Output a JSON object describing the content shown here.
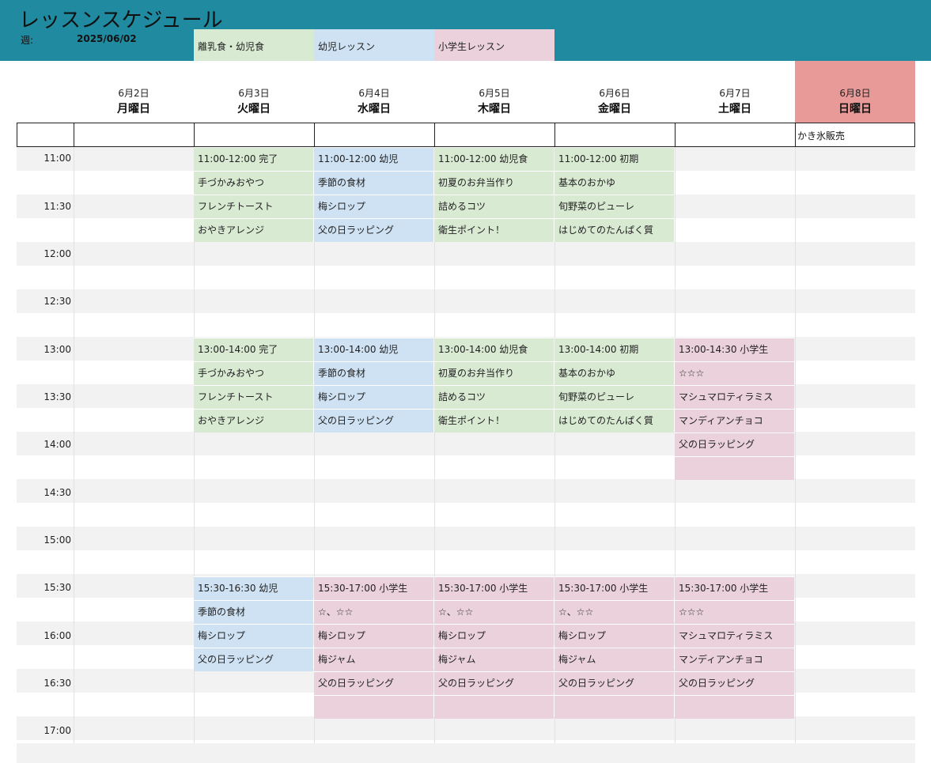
{
  "title": "レッスンスケジュール",
  "week_label": "週:",
  "week_value": "2025/06/02",
  "legend": [
    {
      "label": "離乳食・幼児食",
      "color": "#d9ead3"
    },
    {
      "label": "幼児レッスン",
      "color": "#cfe2f3"
    },
    {
      "label": "小学生レッスン",
      "color": "#ead1dc"
    }
  ],
  "days": [
    {
      "date": "6月2日",
      "dow": "月曜日"
    },
    {
      "date": "6月3日",
      "dow": "火曜日"
    },
    {
      "date": "6月4日",
      "dow": "水曜日"
    },
    {
      "date": "6月5日",
      "dow": "木曜日"
    },
    {
      "date": "6月6日",
      "dow": "金曜日"
    },
    {
      "date": "6月7日",
      "dow": "土曜日"
    },
    {
      "date": "6月8日",
      "dow": "日曜日"
    }
  ],
  "sunday_note": "かき氷販売",
  "times": [
    "11:00",
    "11:30",
    "12:00",
    "12:30",
    "13:00",
    "13:30",
    "14:00",
    "14:30",
    "15:00",
    "15:30",
    "16:00",
    "16:30",
    "17:00"
  ],
  "lessons": {
    "tue_1100": [
      "11:00-12:00  完了",
      "手づかみおやつ",
      "フレンチトースト",
      "おやきアレンジ"
    ],
    "wed_1100": [
      "11:00-12:00  幼児",
      "季節の食材",
      "梅シロップ",
      "父の日ラッピング"
    ],
    "thu_1100": [
      "11:00-12:00  幼児食",
      "初夏のお弁当作り",
      "詰めるコツ",
      "衛生ポイント！"
    ],
    "fri_1100": [
      "11:00-12:00  初期",
      "基本のおかゆ",
      "旬野菜のピューレ",
      "はじめてのたんぱく質"
    ],
    "tue_1300": [
      "13:00-14:00  完了",
      "手づかみおやつ",
      "フレンチトースト",
      "おやきアレンジ"
    ],
    "wed_1300": [
      "13:00-14:00  幼児",
      "季節の食材",
      "梅シロップ",
      "父の日ラッピング"
    ],
    "thu_1300": [
      "13:00-14:00  幼児食",
      "初夏のお弁当作り",
      "詰めるコツ",
      "衛生ポイント！"
    ],
    "fri_1300": [
      "13:00-14:00  初期",
      "基本のおかゆ",
      "旬野菜のピューレ",
      "はじめてのたんぱく質"
    ],
    "sat_1300": [
      "13:00-14:30  小学生",
      "☆☆☆",
      "マシュマロティラミス",
      "マンディアンチョコ",
      "父の日ラッピング",
      ""
    ],
    "tue_1530": [
      "15:30-16:30  幼児",
      "季節の食材",
      "梅シロップ",
      "父の日ラッピング"
    ],
    "wed_1530": [
      "15:30-17:00  小学生",
      "☆、☆☆",
      "梅シロップ",
      "梅ジャム",
      "父の日ラッピング",
      ""
    ],
    "thu_1530": [
      "15:30-17:00  小学生",
      "☆、☆☆",
      "梅シロップ",
      "梅ジャム",
      "父の日ラッピング",
      ""
    ],
    "fri_1530": [
      "15:30-17:00  小学生",
      "☆、☆☆",
      "梅シロップ",
      "梅ジャム",
      "父の日ラッピング",
      ""
    ],
    "sat_1530": [
      "15:30-17:00  小学生",
      "☆☆☆",
      "マシュマロティラミス",
      "マンディアンチョコ",
      "父の日ラッピング",
      ""
    ]
  }
}
